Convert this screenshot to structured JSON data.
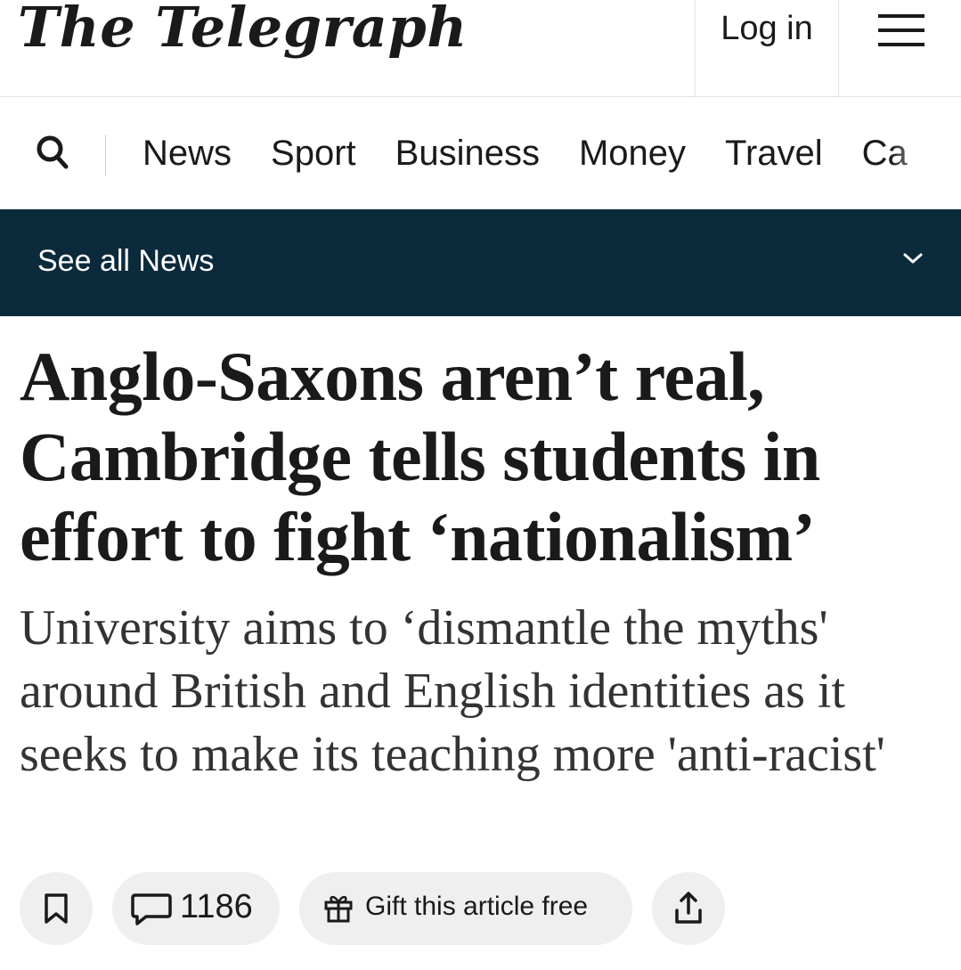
{
  "masthead": {
    "logo": "The Telegraph",
    "login_label": "Log in",
    "menu_icon": "hamburger-menu-icon"
  },
  "nav": {
    "search_icon": "search-icon",
    "items": [
      "News",
      "Sport",
      "Business",
      "Money",
      "Travel",
      "Ca"
    ]
  },
  "subnav": {
    "label": "See all News",
    "chevron_icon": "chevron-down-icon",
    "background": "#0b2a3c"
  },
  "article": {
    "headline": "Anglo-Saxons aren’t real, Cambridge tells students in effort to fight ‘nationalism’",
    "standfirst": "University aims to ‘dismantle the myths' around British and English identities as it seeks to make its teaching more 'anti-racist'"
  },
  "actions": {
    "bookmark_icon": "bookmark-icon",
    "comment_icon": "comment-icon",
    "comments_count": "1186",
    "gift_icon": "gift-icon",
    "gift_label": "Gift this article free",
    "share_icon": "share-icon"
  }
}
